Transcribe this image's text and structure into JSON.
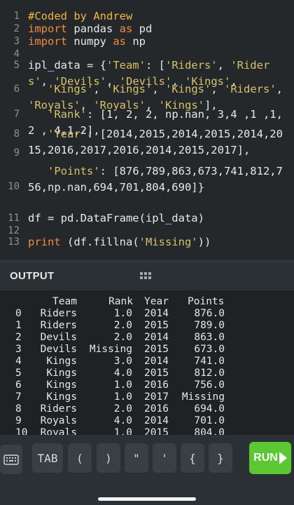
{
  "editor": {
    "line_numbers": [
      "1",
      "2",
      "3",
      "4",
      "5",
      "6",
      "7",
      "8",
      "9",
      "10",
      "11",
      "12",
      "13"
    ],
    "comment": "#Coded by Andrew",
    "line2": {
      "kw1": "import",
      "mid": " pandas ",
      "kw2": "as",
      "end": " pd"
    },
    "line3": {
      "kw1": "import",
      "mid": " numpy ",
      "kw2": "as",
      "end": " np"
    },
    "line5": {
      "pre": "ipl_data = {",
      "team_key": "'Team'",
      "colon": ": [",
      "s1": "'Riders'",
      "c1": ", ",
      "s2": "'Riders'",
      "c2": ", ",
      "s3": "'Devils'",
      "c3": ", ",
      "s4": "'Devils'",
      "c4": ", ",
      "s5": "'Kings'",
      "c5": ","
    },
    "line6": {
      "pre": "   ",
      "s1": "'Kings'",
      "c1": ", ",
      "s2": "'Kings'",
      "c2": ", ",
      "s3": "'Kings'",
      "c3": ", ",
      "s4": "'Riders'",
      "c4": ", ",
      "s5": "'Royals'",
      "c5": ", ",
      "s6": "'Royals'",
      "c6": ", ",
      "s7": "'Kings'",
      "c7": "],"
    },
    "line7": {
      "pre": "   ",
      "rank_key": "'Rank'",
      "rest": ": [1, 2, 2, np.nan, 3,4 ,1 ,1,2 , 4,1,2],"
    },
    "line8": {
      "pre": "   ",
      "year_key": "'Year'",
      "rest": ": [2014,2015,2014,2015,2014,2015,2016,2017,2016,2014,2015,2017],"
    },
    "line9": {
      "pre": "   ",
      "points_key": "'Points'",
      "rest": ": [876,789,863,673,741,812,756,np.nan,694,701,804,690]}"
    },
    "line11": "df = pd.DataFrame(ipl_data)",
    "line13": {
      "kw": "print",
      "pre": " (df.fillna(",
      "s": "'Missing'",
      "post": "))"
    }
  },
  "output": {
    "title": "OUTPUT",
    "headers": [
      "Team",
      "Rank",
      "Year",
      "Points"
    ],
    "rows": [
      {
        "idx": "0",
        "team": "Riders",
        "rank": "1.0",
        "year": "2014",
        "points": "876.0"
      },
      {
        "idx": "1",
        "team": "Riders",
        "rank": "2.0",
        "year": "2015",
        "points": "789.0"
      },
      {
        "idx": "2",
        "team": "Devils",
        "rank": "2.0",
        "year": "2014",
        "points": "863.0"
      },
      {
        "idx": "3",
        "team": "Devils",
        "rank": "Missing",
        "year": "2015",
        "points": "673.0"
      },
      {
        "idx": "4",
        "team": "Kings",
        "rank": "3.0",
        "year": "2014",
        "points": "741.0"
      },
      {
        "idx": "5",
        "team": "Kings",
        "rank": "4.0",
        "year": "2015",
        "points": "812.0"
      },
      {
        "idx": "6",
        "team": "Kings",
        "rank": "1.0",
        "year": "2016",
        "points": "756.0"
      },
      {
        "idx": "7",
        "team": "Kings",
        "rank": "1.0",
        "year": "2017",
        "points": "Missing"
      },
      {
        "idx": "8",
        "team": "Riders",
        "rank": "2.0",
        "year": "2016",
        "points": "694.0"
      },
      {
        "idx": "9",
        "team": "Royals",
        "rank": "4.0",
        "year": "2014",
        "points": "701.0"
      },
      {
        "idx": "10",
        "team": "Royals",
        "rank": "1.0",
        "year": "2015",
        "points": "804.0"
      }
    ]
  },
  "toolbar": {
    "keyboard_icon": "keyboard-icon",
    "tab_label": "TAB",
    "keys": [
      "(",
      ")",
      "\"",
      "'",
      "{",
      "}"
    ],
    "run_label": "RUN",
    "run_color": "#5ac733"
  }
}
